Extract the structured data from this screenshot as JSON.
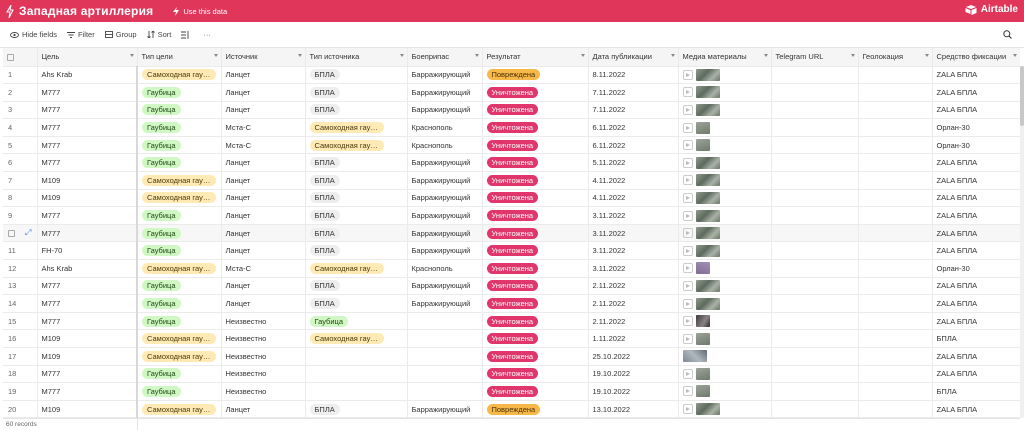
{
  "topbar": {
    "title": "Западная артиллерия",
    "use_data": "Use this data",
    "brand": "Airtable"
  },
  "toolbar": {
    "hide_fields": "Hide fields",
    "filter": "Filter",
    "group": "Group",
    "sort": "Sort",
    "more": "···"
  },
  "columns": [
    "Цель",
    "Тип цели",
    "Источник",
    "Тип источника",
    "Боеприпас",
    "Результат",
    "Дата публикации",
    "Медиа материалы",
    "Telegram URL",
    "Геолокация",
    "Средство фиксации"
  ],
  "rows": [
    {
      "n": "1",
      "target": "Ahs Krab",
      "ttype": "Самоходная гаубица",
      "src": "Ланцет",
      "stype": "БПЛА",
      "ammo": "Барражирующий",
      "result": "Повреждена",
      "date": "8.11.2022",
      "media": "thumb",
      "fix": "ZALA БПЛА"
    },
    {
      "n": "2",
      "target": "M777",
      "ttype": "Гаубица",
      "src": "Ланцет",
      "stype": "БПЛА",
      "ammo": "Барражирующий",
      "result": "Уничтожена",
      "date": "7.11.2022",
      "media": "thumb",
      "fix": "ZALA БПЛА"
    },
    {
      "n": "3",
      "target": "M777",
      "ttype": "Гаубица",
      "src": "Ланцет",
      "stype": "БПЛА",
      "ammo": "Барражирующий",
      "result": "Уничтожена",
      "date": "7.11.2022",
      "media": "thumb",
      "fix": "ZALA БПЛА"
    },
    {
      "n": "4",
      "target": "M777",
      "ttype": "Гаубица",
      "src": "Мста-С",
      "stype": "Самоходная гаубица",
      "ammo": "Краснополь",
      "result": "Уничтожена",
      "date": "6.11.2022",
      "media": "small",
      "fix": "Орлан-30"
    },
    {
      "n": "5",
      "target": "M777",
      "ttype": "Гаубица",
      "src": "Мста-С",
      "stype": "Самоходная гаубица",
      "ammo": "Краснополь",
      "result": "Уничтожена",
      "date": "6.11.2022",
      "media": "small",
      "fix": "Орлан-30"
    },
    {
      "n": "6",
      "target": "M777",
      "ttype": "Гаубица",
      "src": "Ланцет",
      "stype": "БПЛА",
      "ammo": "Барражирующий",
      "result": "Уничтожена",
      "date": "5.11.2022",
      "media": "thumb",
      "fix": "ZALA БПЛА"
    },
    {
      "n": "7",
      "target": "M109",
      "ttype": "Самоходная гаубица",
      "src": "Ланцет",
      "stype": "БПЛА",
      "ammo": "Барражирующий",
      "result": "Уничтожена",
      "date": "4.11.2022",
      "media": "thumb",
      "fix": "ZALA БПЛА"
    },
    {
      "n": "8",
      "target": "M109",
      "ttype": "Самоходная гаубица",
      "src": "Ланцет",
      "stype": "БПЛА",
      "ammo": "Барражирующий",
      "result": "Уничтожена",
      "date": "4.11.2022",
      "media": "thumb",
      "fix": "ZALA БПЛА"
    },
    {
      "n": "9",
      "target": "M777",
      "ttype": "Гаубица",
      "src": "Ланцет",
      "stype": "БПЛА",
      "ammo": "Барражирующий",
      "result": "Уничтожена",
      "date": "3.11.2022",
      "media": "thumb",
      "fix": "ZALA БПЛА"
    },
    {
      "n": "",
      "target": "M777",
      "ttype": "Гаубица",
      "src": "Ланцет",
      "stype": "БПЛА",
      "ammo": "Барражирующий",
      "result": "Уничтожена",
      "date": "3.11.2022",
      "media": "thumb",
      "fix": "ZALA БПЛА",
      "hl": true
    },
    {
      "n": "11",
      "target": "FH-70",
      "ttype": "Гаубица",
      "src": "Ланцет",
      "stype": "БПЛА",
      "ammo": "Барражирующий",
      "result": "Уничтожена",
      "date": "3.11.2022",
      "media": "thumb",
      "fix": "ZALA БПЛА"
    },
    {
      "n": "12",
      "target": "Ahs Krab",
      "ttype": "Самоходная гаубица",
      "src": "Мста-С",
      "stype": "Самоходная гаубица",
      "ammo": "Краснополь",
      "result": "Уничтожена",
      "date": "3.11.2022",
      "media": "purple",
      "fix": "Орлан-30"
    },
    {
      "n": "13",
      "target": "M777",
      "ttype": "Гаубица",
      "src": "Ланцет",
      "stype": "БПЛА",
      "ammo": "Барражирующий",
      "result": "Уничтожена",
      "date": "2.11.2022",
      "media": "thumb",
      "fix": "ZALA БПЛА"
    },
    {
      "n": "14",
      "target": "M777",
      "ttype": "Гаубица",
      "src": "Ланцет",
      "stype": "БПЛА",
      "ammo": "Барражирующий",
      "result": "Уничтожена",
      "date": "2.11.2022",
      "media": "thumb",
      "fix": "ZALA БПЛА"
    },
    {
      "n": "15",
      "target": "M777",
      "ttype": "Гаубица",
      "src": "Неизвестно",
      "stype": "Гаубица",
      "ammo": "",
      "result": "Уничтожена",
      "date": "2.11.2022",
      "media": "dark",
      "fix": "ZALA БПЛА"
    },
    {
      "n": "16",
      "target": "M109",
      "ttype": "Самоходная гаубица",
      "src": "Неизвестно",
      "stype": "Самоходная гаубица",
      "ammo": "",
      "result": "Уничтожена",
      "date": "1.11.2022",
      "media": "small",
      "fix": "БПЛА"
    },
    {
      "n": "17",
      "target": "M109",
      "ttype": "Самоходная гаубица",
      "src": "Неизвестно",
      "stype": "",
      "ammo": "",
      "result": "Уничтожена",
      "date": "25.10.2022",
      "media": "nothumbplay",
      "fix": "ZALA БПЛА"
    },
    {
      "n": "18",
      "target": "M777",
      "ttype": "Гаубица",
      "src": "Неизвестно",
      "stype": "",
      "ammo": "",
      "result": "Уничтожена",
      "date": "19.10.2022",
      "media": "small",
      "fix": "ZALA БПЛА"
    },
    {
      "n": "19",
      "target": "M777",
      "ttype": "Гаубица",
      "src": "Неизвестно",
      "stype": "",
      "ammo": "",
      "result": "Уничтожена",
      "date": "19.10.2022",
      "media": "small",
      "fix": "БПЛА"
    },
    {
      "n": "20",
      "target": "M109",
      "ttype": "Самоходная гаубица",
      "src": "Ланцет",
      "stype": "БПЛА",
      "ammo": "Барражирующий",
      "result": "Повреждена",
      "date": "13.10.2022",
      "media": "thumb",
      "fix": "ZALA БПЛА"
    }
  ],
  "footer": {
    "records": "60 records"
  },
  "colors": {
    "brand": "#e0365a",
    "chip_green": "#d1f7c4",
    "chip_yellow": "#ffeab6",
    "chip_pink": "#e0366b",
    "chip_orange": "#f7b84a"
  },
  "icons": {
    "logo": "bolt-icon",
    "use_data": "bolt-icon",
    "brand": "airtable-logo-icon",
    "hide": "eye-icon",
    "filter": "filter-icon",
    "group": "group-icon",
    "sort": "sort-icon",
    "row_height": "row-height-icon",
    "search": "search-icon"
  }
}
